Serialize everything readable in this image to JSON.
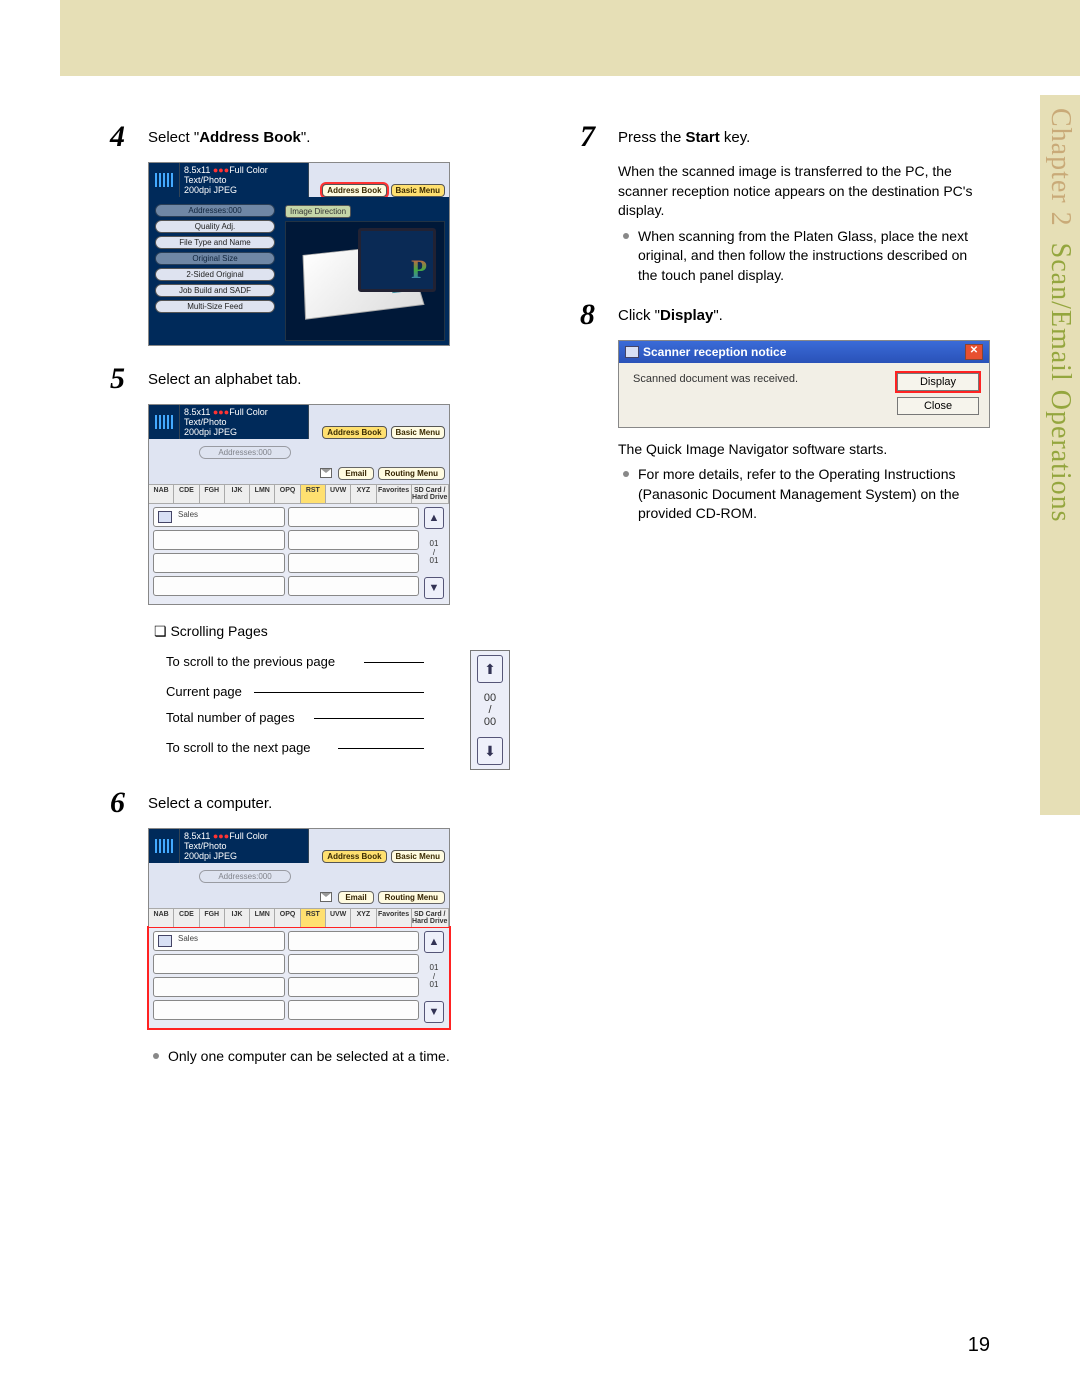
{
  "chapter_tab": {
    "chapter": "Chapter 2",
    "title": "Scan/Email Operations"
  },
  "page_number": "19",
  "steps": {
    "s4": {
      "num": "4",
      "text_pre": "Select \"",
      "bold": "Address Book",
      "text_post": "\"."
    },
    "s5": {
      "num": "5",
      "text": "Select an alphabet tab."
    },
    "s6": {
      "num": "6",
      "text": "Select a computer."
    },
    "s6_note": "Only one computer can be selected at a time.",
    "s7": {
      "num": "7",
      "text_pre": "Press the ",
      "bold": "Start",
      "text_post": " key."
    },
    "s7_body": "When the scanned image is transferred to the PC, the scanner reception notice appears on the destination PC's display.",
    "s7_bullet": "When scanning from the Platen Glass, place the next original, and then follow the instructions described on the touch panel display.",
    "s8": {
      "num": "8",
      "text_pre": "Click \"",
      "bold": "Display",
      "text_post": "\"."
    },
    "s8_body": "The Quick Image Navigator software starts.",
    "s8_bullet": "For more details, refer to the Operating Instructions (Panasonic Document Management System) on the provided CD-ROM."
  },
  "scrolling_heading": "Scrolling Pages",
  "scroll_legend": {
    "prev": "To scroll to the previous page",
    "curr": "Current page",
    "total": "Total number of pages",
    "next": "To scroll to the next page",
    "val_curr": "00",
    "sep": "/",
    "val_total": "00"
  },
  "panel": {
    "size": "8.5x11",
    "mode": "Full Color",
    "type": "Text/Photo",
    "res": "200dpi JPEG",
    "addr_label": "Addresses:000",
    "tab_address": "Address Book",
    "tab_basic": "Basic Menu",
    "img_dir": "Image Direction",
    "opts": [
      "Quality Adj.",
      "File Type and Name",
      "Original Size",
      "2-Sided Original",
      "Job Build and SADF",
      "Multi-Size Feed"
    ],
    "bar2_email": "Email",
    "bar2_routing": "Routing Menu",
    "alpha": [
      "NAB",
      "CDE",
      "FGH",
      "IJK",
      "LMN",
      "OPQ",
      "RST",
      "UVW",
      "XYZ",
      "Favorites",
      "SD Card / Hard Drive"
    ],
    "entry": "Sales",
    "page_ind": {
      "cur": "01",
      "sep": "/",
      "tot": "01"
    }
  },
  "win": {
    "title": "Scanner reception notice",
    "msg": "Scanned document was received.",
    "btn_display": "Display",
    "btn_close": "Close"
  }
}
